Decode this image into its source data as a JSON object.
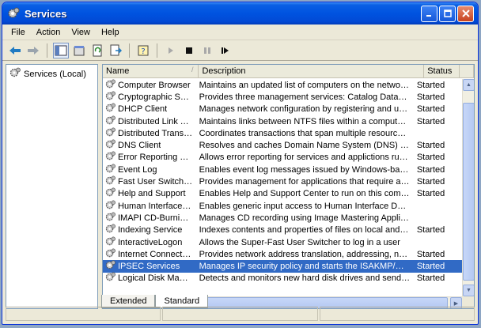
{
  "window": {
    "title": "Services"
  },
  "menu": [
    {
      "label": "File",
      "accel": "F"
    },
    {
      "label": "Action",
      "accel": "A"
    },
    {
      "label": "View",
      "accel": "V"
    },
    {
      "label": "Help",
      "accel": "H"
    }
  ],
  "tree": {
    "root_label": "Services (Local)"
  },
  "columns": {
    "name": "Name",
    "description": "Description",
    "status": "Status"
  },
  "services": [
    {
      "name": "Computer Browser",
      "description": "Maintains an updated list of computers on the network and ...",
      "status": "Started"
    },
    {
      "name": "Cryptographic Servi...",
      "description": "Provides three management services: Catalog Database S...",
      "status": "Started"
    },
    {
      "name": "DHCP Client",
      "description": "Manages network configuration by registering and updatin...",
      "status": "Started"
    },
    {
      "name": "Distributed Link Tra...",
      "description": "Maintains links between NTFS files within a computer or a...",
      "status": "Started"
    },
    {
      "name": "Distributed Transac...",
      "description": "Coordinates transactions that span multiple resource mana...",
      "status": ""
    },
    {
      "name": "DNS Client",
      "description": "Resolves and caches Domain Name System (DNS) names f...",
      "status": "Started"
    },
    {
      "name": "Error Reporting Ser...",
      "description": "Allows error reporting for services and applictions running i...",
      "status": "Started"
    },
    {
      "name": "Event Log",
      "description": "Enables event log messages issued by Windows-based pro...",
      "status": "Started"
    },
    {
      "name": "Fast User Switching...",
      "description": "Provides management for applications that require assista...",
      "status": "Started"
    },
    {
      "name": "Help and Support",
      "description": "Enables Help and Support Center to run on this computer. ...",
      "status": "Started"
    },
    {
      "name": "Human Interface D...",
      "description": "Enables generic input access to Human Interface Devices (...",
      "status": ""
    },
    {
      "name": "IMAPI CD-Burning C...",
      "description": "Manages CD recording using Image Mastering Applications ...",
      "status": ""
    },
    {
      "name": "Indexing Service",
      "description": "Indexes contents and properties of files on local and remot...",
      "status": "Started"
    },
    {
      "name": "InteractiveLogon",
      "description": "Allows the Super-Fast User Switcher to log in a user",
      "status": ""
    },
    {
      "name": "Internet Connectio...",
      "description": "Provides network address translation, addressing, name re...",
      "status": "Started"
    },
    {
      "name": "IPSEC Services",
      "description": "Manages IP security policy and starts the ISAKMP/Oakley (...",
      "status": "Started",
      "selected": true
    },
    {
      "name": "Logical Disk Manager",
      "description": "Detects and monitors new hard disk drives and sends disk ...",
      "status": "Started"
    }
  ],
  "tabs": [
    {
      "label": "Extended",
      "active": false
    },
    {
      "label": "Standard",
      "active": true
    }
  ],
  "colors": {
    "title_bar": "#0053e0",
    "selection": "#316ac5",
    "chrome": "#ece9d8"
  },
  "icons": [
    "services-icon",
    "back-arrow-icon",
    "forward-arrow-icon",
    "console-tree-icon",
    "properties-icon",
    "refresh-icon",
    "export-list-icon",
    "help-icon",
    "play-icon",
    "stop-icon",
    "pause-icon",
    "restart-icon",
    "gear-icon"
  ]
}
